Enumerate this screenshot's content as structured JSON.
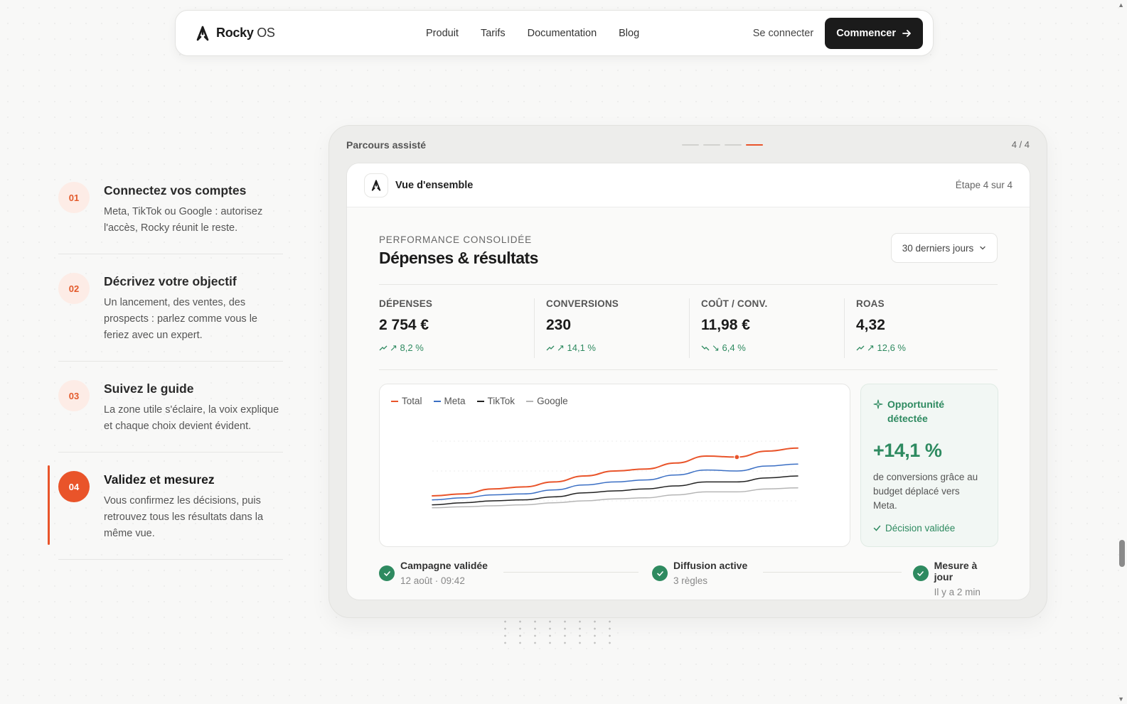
{
  "navbar": {
    "brand": "Rocky",
    "brand_suffix": "OS",
    "links": [
      "Produit",
      "Tarifs",
      "Documentation",
      "Blog"
    ],
    "signin": "Se connecter",
    "cta": "Commencer"
  },
  "steps": [
    {
      "num": "01",
      "title": "Connectez vos comptes",
      "desc": "Meta, TikTok ou Google : autorisez l'accès, Rocky réunit le reste."
    },
    {
      "num": "02",
      "title": "Décrivez votre objectif",
      "desc": "Un lancement, des ventes, des prospects : parlez comme vous le feriez avec un expert."
    },
    {
      "num": "03",
      "title": "Suivez le guide",
      "desc": "La zone utile s'éclaire, la voix explique et chaque choix devient évident."
    },
    {
      "num": "04",
      "title": "Validez et mesurez",
      "desc": "Vous confirmez les décisions, puis retrouvez tous les résultats dans la même vue."
    }
  ],
  "frame": {
    "label": "Parcours assisté",
    "count": "4 / 4"
  },
  "card": {
    "title": "Vue d'ensemble",
    "step": "Étape 4 sur 4",
    "eyebrow": "PERFORMANCE CONSOLIDÉE",
    "heading": "Dépenses & résultats",
    "period": "30 derniers jours"
  },
  "kpis": [
    {
      "label": "DÉPENSES",
      "value": "2 754 €",
      "delta": "↗ 8,2 %"
    },
    {
      "label": "CONVERSIONS",
      "value": "230",
      "delta": "↗ 14,1 %"
    },
    {
      "label": "COÛT / CONV.",
      "value": "11,98 €",
      "delta": "↘ 6,4 %"
    },
    {
      "label": "ROAS",
      "value": "4,32",
      "delta": "↗ 12,6 %"
    }
  ],
  "chart_data": {
    "type": "line",
    "x": [
      0,
      1,
      2,
      3,
      4,
      5,
      6,
      7,
      8,
      9,
      10,
      11,
      12
    ],
    "ylim": [
      0,
      100
    ],
    "series": [
      {
        "name": "Total",
        "color": "#e9542a",
        "values": [
          20,
          22,
          27,
          29,
          34,
          40,
          45,
          47,
          53,
          60,
          59,
          65,
          68
        ]
      },
      {
        "name": "Meta",
        "color": "#3b6fc4",
        "values": [
          16,
          18,
          21,
          22,
          26,
          31,
          34,
          36,
          41,
          46,
          45,
          50,
          52
        ]
      },
      {
        "name": "TikTok",
        "color": "#222222",
        "values": [
          11,
          13,
          15,
          16,
          19,
          23,
          25,
          27,
          30,
          34,
          34,
          38,
          40
        ]
      },
      {
        "name": "Google",
        "color": "#b5b5b5",
        "values": [
          8,
          9,
          10,
          11,
          13,
          15,
          17,
          18,
          21,
          24,
          24,
          27,
          28
        ]
      }
    ],
    "highlight": {
      "series": "Total",
      "index": 10
    }
  },
  "opportunity": {
    "title": "Opportunité détectée",
    "value": "+14,1 %",
    "desc": "de conversions grâce au budget déplacé vers Meta.",
    "footer": "Décision validée"
  },
  "timeline": [
    {
      "title": "Campagne validée",
      "sub": "12 août · 09:42"
    },
    {
      "title": "Diffusion active",
      "sub": "3 règles"
    },
    {
      "title": "Mesure à jour",
      "sub": "Il y a 2 min"
    }
  ]
}
